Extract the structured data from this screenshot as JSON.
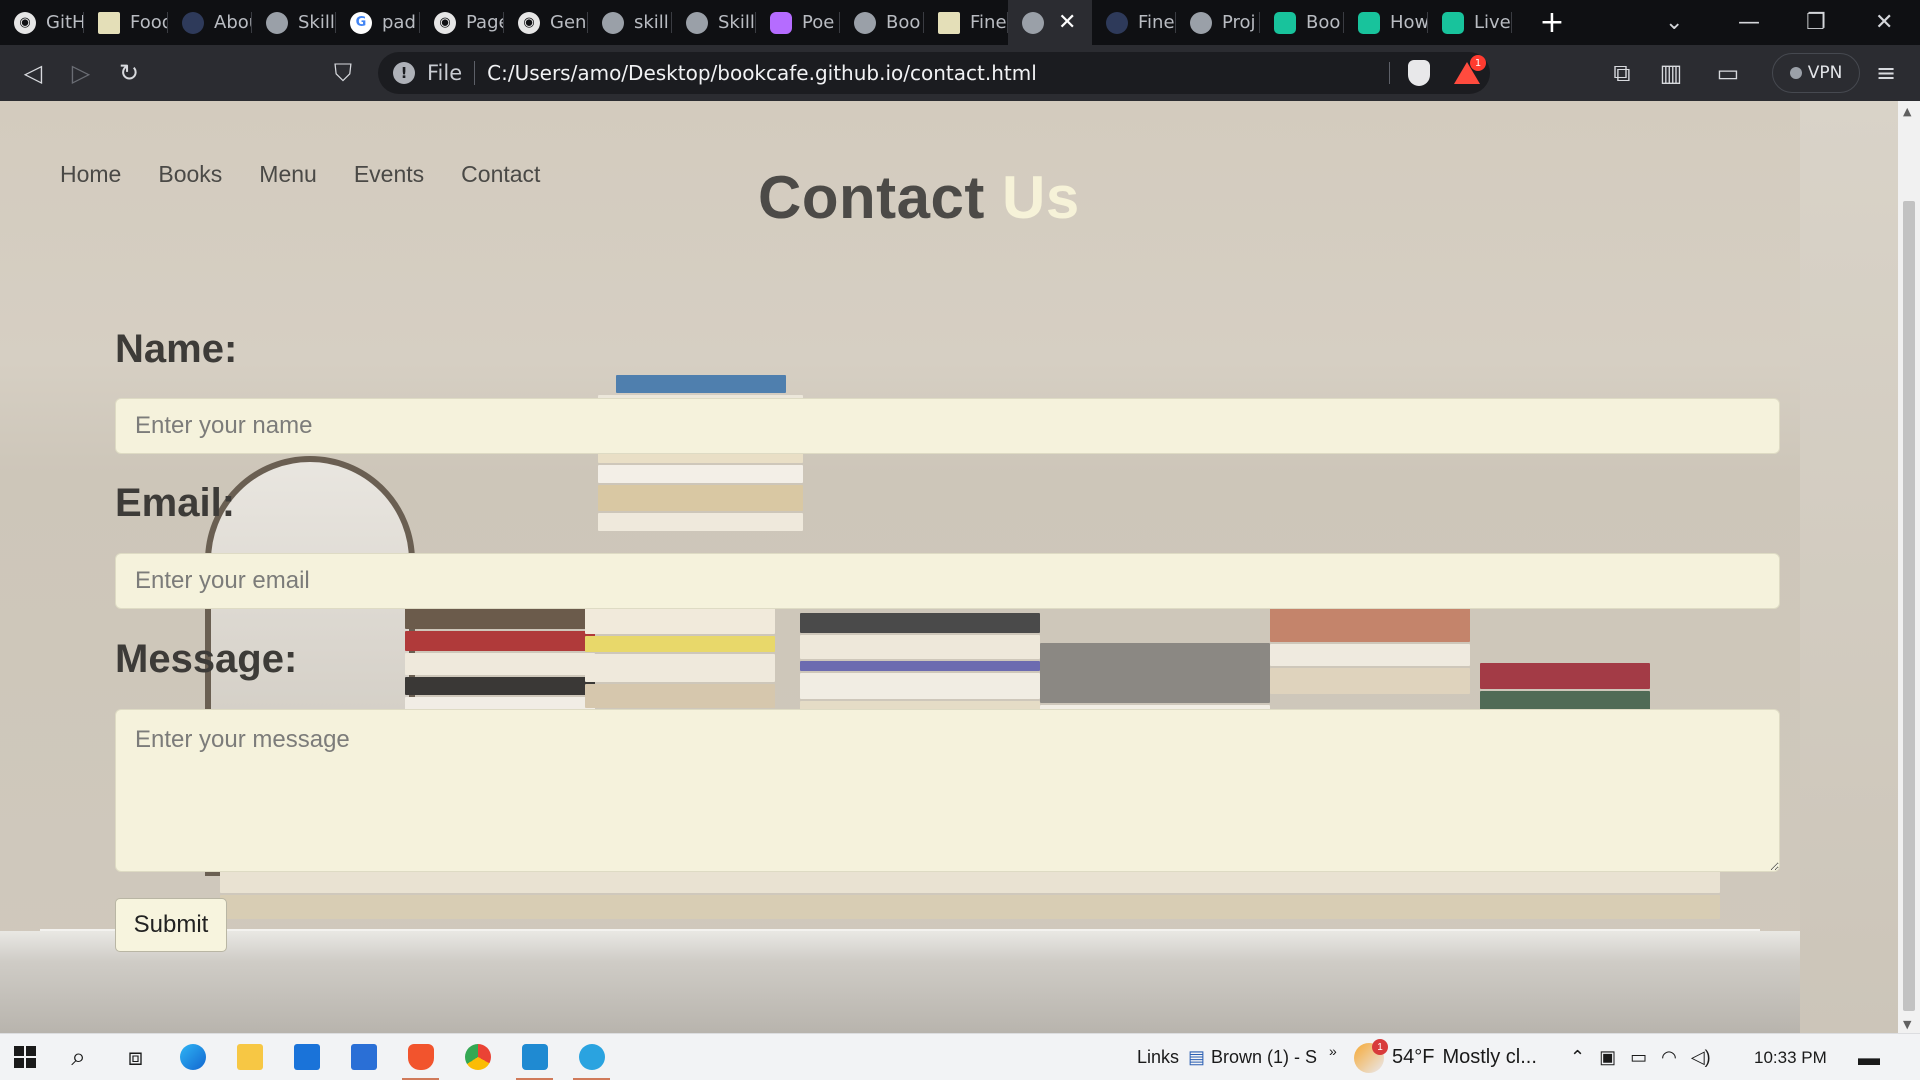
{
  "browser": {
    "tabs": [
      {
        "title": "GitHub",
        "icon": "github-icon"
      },
      {
        "title": "Food",
        "icon": "food-icon"
      },
      {
        "title": "About",
        "icon": "dark-icon"
      },
      {
        "title": "Skills",
        "icon": "globe-icon"
      },
      {
        "title": "pad",
        "icon": "google-icon"
      },
      {
        "title": "Pages",
        "icon": "github-icon"
      },
      {
        "title": "Gen",
        "icon": "github-icon"
      },
      {
        "title": "skill",
        "icon": "globe-icon"
      },
      {
        "title": "Skill",
        "icon": "globe-icon"
      },
      {
        "title": "Poe",
        "icon": "poe-icon"
      },
      {
        "title": "Boo",
        "icon": "globe-icon"
      },
      {
        "title": "Fine",
        "icon": "note-icon"
      },
      {
        "title": "",
        "icon": "globe-icon",
        "active": true
      },
      {
        "title": "Fine",
        "icon": "dark-icon"
      },
      {
        "title": "Proj",
        "icon": "globe-icon"
      },
      {
        "title": "Boo",
        "icon": "bookmark-green-icon"
      },
      {
        "title": "How",
        "icon": "bookmark-green-icon"
      },
      {
        "title": "Live",
        "icon": "bookmark-green-icon"
      }
    ],
    "address": {
      "scheme": "File",
      "url": "C:/Users/amo/Desktop/bookcafe.github.io/contact.html"
    },
    "rewards_badge": "1",
    "vpn_label": "VPN"
  },
  "page": {
    "nav": [
      "Home",
      "Books",
      "Menu",
      "Events",
      "Contact"
    ],
    "heading_word1": "Contact",
    "heading_word2": "Us",
    "form": {
      "name_label": "Name:",
      "name_placeholder": "Enter your name",
      "email_label": "Email:",
      "email_placeholder": "Enter your email",
      "message_label": "Message:",
      "message_placeholder": "Enter your message",
      "submit_label": "Submit"
    }
  },
  "taskbar": {
    "links_label": "Links",
    "pinned_doc": "Brown (1) - S",
    "weather_temp": "54°F",
    "weather_desc": "Mostly cl...",
    "weather_badge": "1",
    "clock": "10:33 PM"
  },
  "colors": {
    "heading_dark": "#4c4a47",
    "heading_light": "#f6f2d8",
    "field_bg": "#f5f2dc",
    "tabbar_bg": "#0f1013",
    "toolbar_bg": "#2b2c31"
  }
}
